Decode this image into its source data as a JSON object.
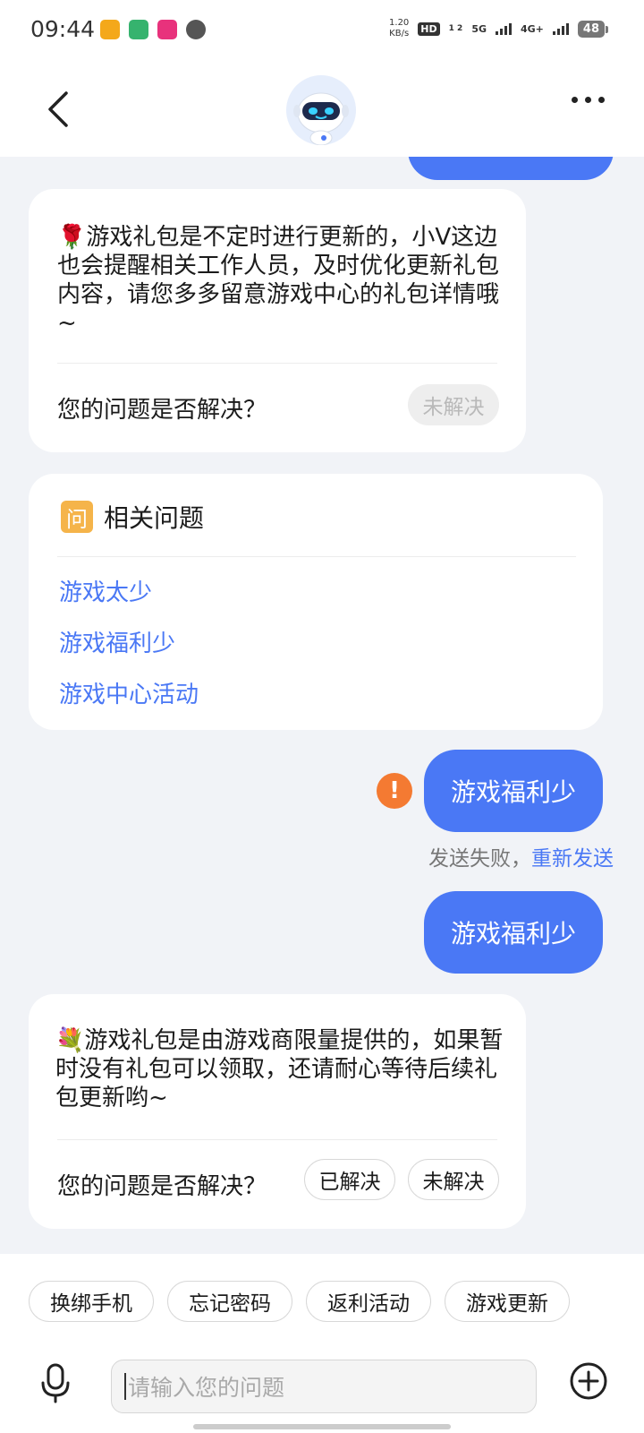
{
  "status_bar": {
    "time": "09:44",
    "net_speed_value": "1.20",
    "net_speed_unit": "KB/s",
    "hd": "HD",
    "sim_labels": "1 2",
    "network_5g": "5G",
    "network_4g": "4G+",
    "battery": "48",
    "app_icon_colors": [
      "#f4a81a",
      "#36b36e",
      "#e8327c",
      "#555555"
    ]
  },
  "header": {
    "avatar_icon": "robot-assistant-icon",
    "back_icon": "chevron-left-icon",
    "more_icon": "more-dots-icon"
  },
  "messages": {
    "bot1": {
      "emoji": "🌹",
      "text": "游戏礼包是不定时进行更新的，小V这边也会提醒相关工作人员，及时优化更新礼包内容，请您多多留意游戏中心的礼包详情哦~",
      "question": "您的问题是否解决？",
      "unresolved": "未解决"
    },
    "related": {
      "icon_char": "问",
      "title": "相关问题",
      "items": [
        "游戏太少",
        "游戏福利少",
        "游戏中心活动"
      ]
    },
    "user_failed": {
      "text": "游戏福利少",
      "fail_text": "发送失败，",
      "resend": "重新发送",
      "error_mark": "!"
    },
    "user_sent": {
      "text": "游戏福利少"
    },
    "bot2": {
      "emoji": "💐",
      "text": "游戏礼包是由游戏商限量提供的，如果暂时没有礼包可以领取，还请耐心等待后续礼包更新哟~",
      "question": "您的问题是否解决？",
      "resolved": "已解决",
      "unresolved": "未解决"
    }
  },
  "quick_replies": [
    "换绑手机",
    "忘记密码",
    "返利活动",
    "游戏更新"
  ],
  "input": {
    "placeholder": "请输入您的问题",
    "mic_icon": "microphone-icon",
    "plus_icon": "plus-circle-icon"
  },
  "colors": {
    "accent": "#4a78f5",
    "error": "#f47a32",
    "background": "#f1f3f7"
  }
}
